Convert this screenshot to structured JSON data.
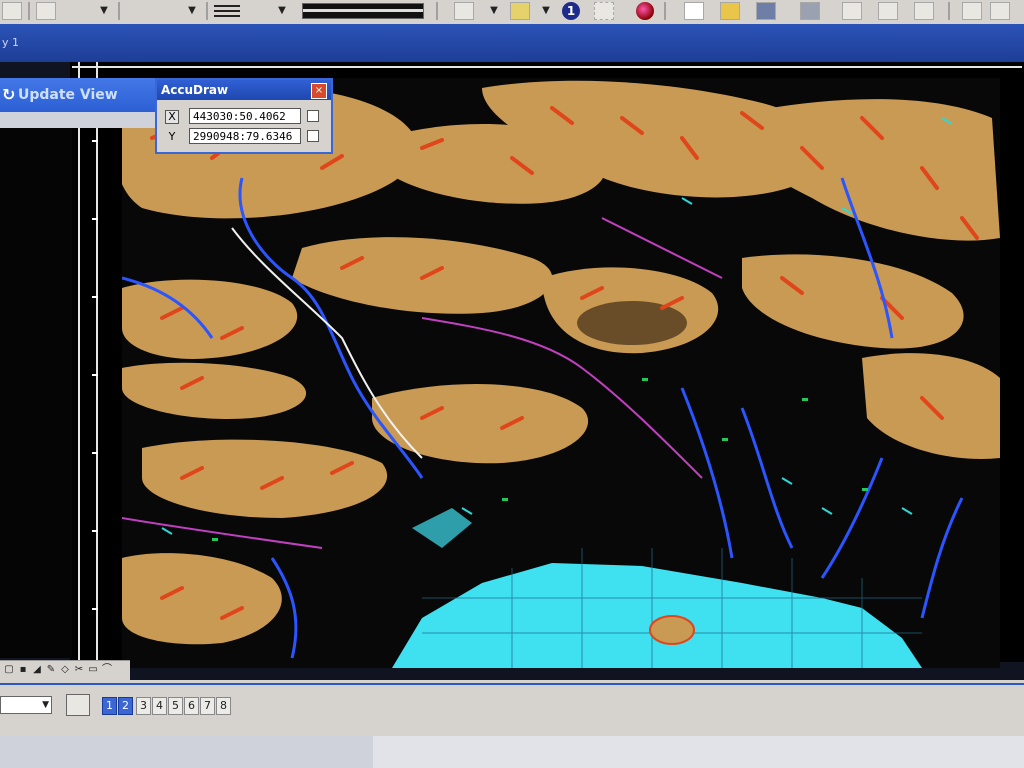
{
  "window": {
    "title": "y 1"
  },
  "toolbar": {
    "info_glyph": "1"
  },
  "update_view": {
    "label": "Update View",
    "icon": "update-view-icon"
  },
  "accudraw": {
    "title": "AccuDraw",
    "close_glyph": "×",
    "x_label": "X",
    "x_value": "443030:50.4062",
    "y_label": "Y",
    "y_value": "2990948:79.6346"
  },
  "view_controls": {
    "views": [
      {
        "label": "1",
        "active": true
      },
      {
        "label": "2",
        "active": true
      },
      {
        "label": "3",
        "active": false
      },
      {
        "label": "4",
        "active": false
      },
      {
        "label": "5",
        "active": false
      },
      {
        "label": "6",
        "active": false
      },
      {
        "label": "7",
        "active": false
      },
      {
        "label": "8",
        "active": false
      }
    ]
  },
  "colors": {
    "terrain": "#c99a53",
    "water": "#3fe0f0",
    "river": "#2a55ff",
    "fault": "#e0461c",
    "background": "#000000",
    "accent": "#2b53b7"
  }
}
